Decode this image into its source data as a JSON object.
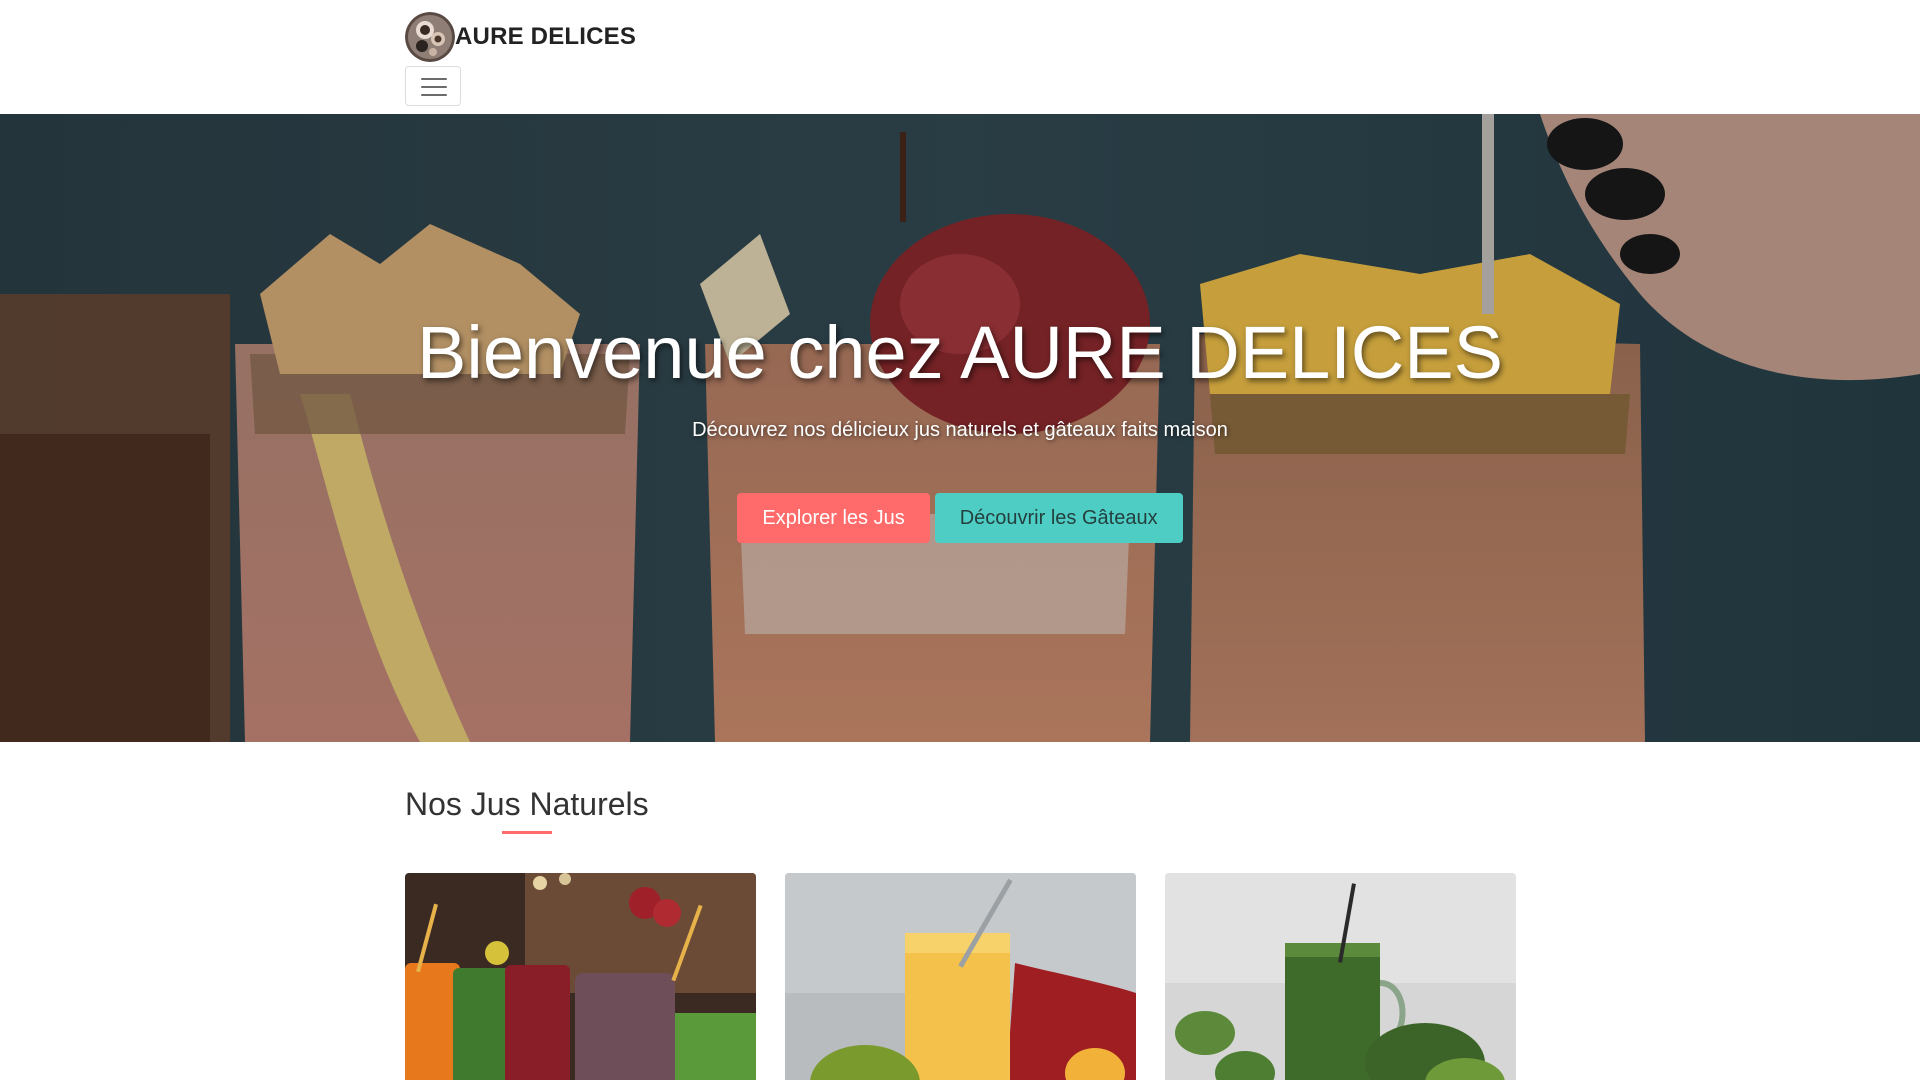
{
  "header": {
    "brand_name": "AURE DELICES",
    "logo_icon": "cake-plate-logo",
    "menu_icon": "hamburger-menu-icon"
  },
  "hero": {
    "title": "Bienvenue chez AURE DELICES",
    "subtitle": "Découvrez nos délicieux jus naturels et gâteaux faits maison",
    "buttons": {
      "primary_label": "Explorer les Jus",
      "secondary_label": "Découvrir les Gâteaux"
    }
  },
  "juices_section": {
    "title": "Nos Jus Naturels",
    "cards": [
      {
        "image": "assorted-juice-jars-photo"
      },
      {
        "image": "mango-smoothie-photo"
      },
      {
        "image": "green-juice-jar-photo"
      }
    ]
  },
  "colors": {
    "accent_primary": "#ff6b6b",
    "accent_secondary": "#4ecdc4",
    "text": "#333333"
  }
}
